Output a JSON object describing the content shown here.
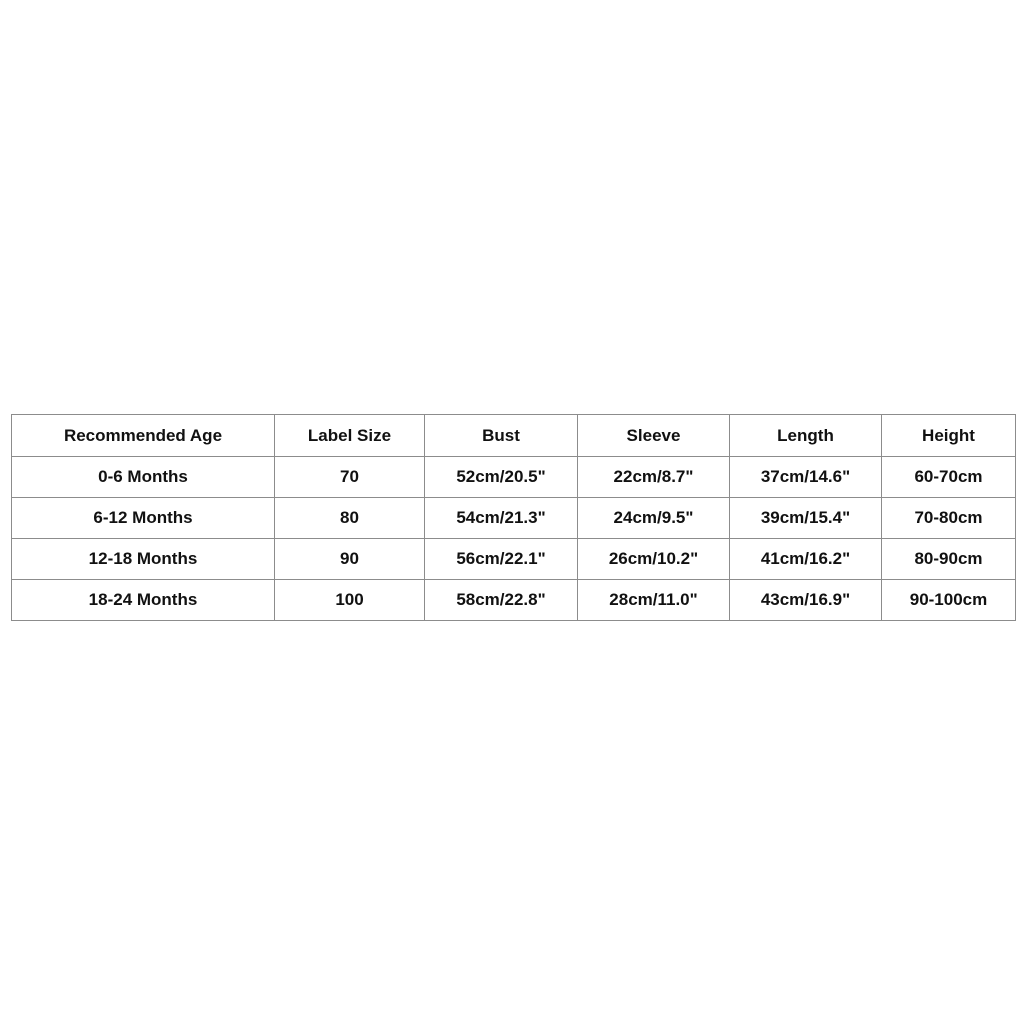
{
  "table": {
    "headers": [
      "Recommended Age",
      "Label Size",
      "Bust",
      "Sleeve",
      "Length",
      "Height"
    ],
    "rows": [
      [
        "0-6 Months",
        "70",
        "52cm/20.5\"",
        "22cm/8.7\"",
        "37cm/14.6\"",
        "60-70cm"
      ],
      [
        "6-12 Months",
        "80",
        "54cm/21.3\"",
        "24cm/9.5\"",
        "39cm/15.4\"",
        "70-80cm"
      ],
      [
        "12-18 Months",
        "90",
        "56cm/22.1\"",
        "26cm/10.2\"",
        "41cm/16.2\"",
        "80-90cm"
      ],
      [
        "18-24 Months",
        "100",
        "58cm/22.8\"",
        "28cm/11.0\"",
        "43cm/16.9\"",
        "90-100cm"
      ]
    ]
  }
}
